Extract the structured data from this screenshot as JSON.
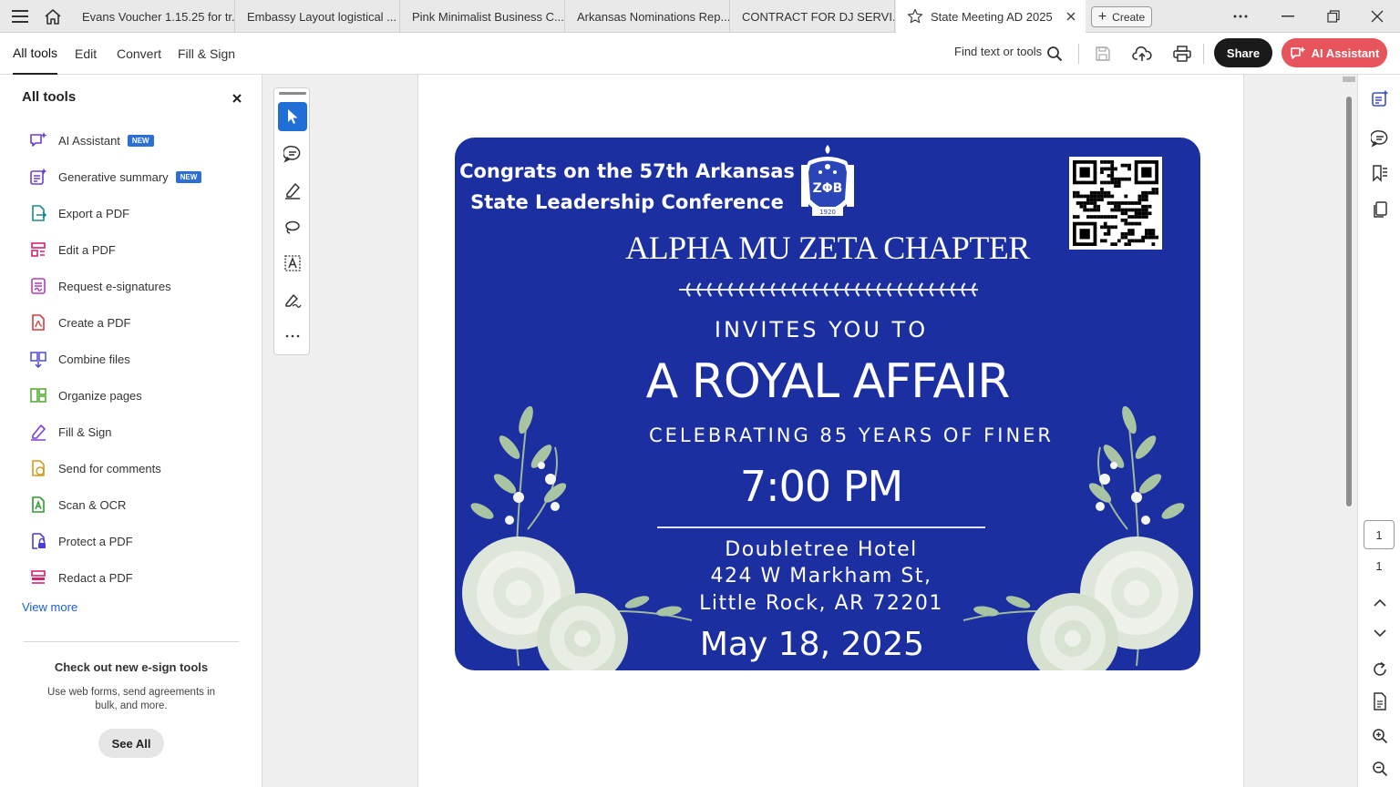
{
  "tabs": [
    {
      "label": "Evans Voucher 1.15.25 for tr..."
    },
    {
      "label": "Embassy Layout logistical ..."
    },
    {
      "label": "Pink Minimalist Business C..."
    },
    {
      "label": "Arkansas Nominations Rep..."
    },
    {
      "label": "CONTRACT FOR DJ SERVI..."
    },
    {
      "label": "State Meeting AD 2025",
      "active": true
    }
  ],
  "create_label": "Create",
  "menu": [
    {
      "label": "All tools",
      "active": true
    },
    {
      "label": "Edit"
    },
    {
      "label": "Convert"
    },
    {
      "label": "Fill & Sign"
    }
  ],
  "find_label": "Find text or tools",
  "share_label": "Share",
  "ai_assistant_label": "AI Assistant",
  "panel": {
    "title": "All tools",
    "tools": [
      {
        "label": "AI Assistant",
        "badge": "NEW",
        "icon": "ai-assistant-icon",
        "color": "#6b3fd4"
      },
      {
        "label": "Generative summary",
        "badge": "NEW",
        "icon": "generative-summary-icon",
        "color": "#6b3fd4"
      },
      {
        "label": "Export a PDF",
        "icon": "export-pdf-icon",
        "color": "#1a8a8a"
      },
      {
        "label": "Edit a PDF",
        "icon": "edit-pdf-icon",
        "color": "#d4236f"
      },
      {
        "label": "Request e-signatures",
        "icon": "request-esign-icon",
        "color": "#b03fb8"
      },
      {
        "label": "Create a PDF",
        "icon": "create-pdf-icon",
        "color": "#d63b3b"
      },
      {
        "label": "Combine files",
        "icon": "combine-files-icon",
        "color": "#4a4ad4"
      },
      {
        "label": "Organize pages",
        "icon": "organize-pages-icon",
        "color": "#4ea82a"
      },
      {
        "label": "Fill & Sign",
        "icon": "fill-sign-icon",
        "color": "#7a3fd4"
      },
      {
        "label": "Send for comments",
        "icon": "send-comments-icon",
        "color": "#d49a1a"
      },
      {
        "label": "Scan & OCR",
        "icon": "scan-ocr-icon",
        "color": "#2f9a2f"
      },
      {
        "label": "Protect a PDF",
        "icon": "protect-pdf-icon",
        "color": "#4a3fd4"
      },
      {
        "label": "Redact a PDF",
        "icon": "redact-pdf-icon",
        "color": "#d4236f"
      }
    ],
    "view_more": "View more",
    "promo_title": "Check out new e-sign tools",
    "promo_text": "Use web forms, send agreements in bulk, and more.",
    "see_all": "See All"
  },
  "flyer": {
    "congrats_line1": "Congrats on the 57th Arkansas",
    "congrats_line2": "State Leadership Conference",
    "crest_letters": "ΖΦΒ",
    "crest_year": "1920",
    "chapter": "ALPHA MU ZETA CHAPTER",
    "invites": "INVITES YOU TO",
    "royal": "A ROYAL AFFAIR",
    "celebrating": "CELEBRATING 85 YEARS OF FINER",
    "time": "7:00 PM",
    "venue_line1": "Doubletree Hotel",
    "venue_line2": "424 W Markham St,",
    "venue_line3": "Little Rock, AR 72201",
    "date": "May 18, 2025",
    "bg_color": "#1b2fa0"
  },
  "page_current": "1",
  "page_total": "1"
}
